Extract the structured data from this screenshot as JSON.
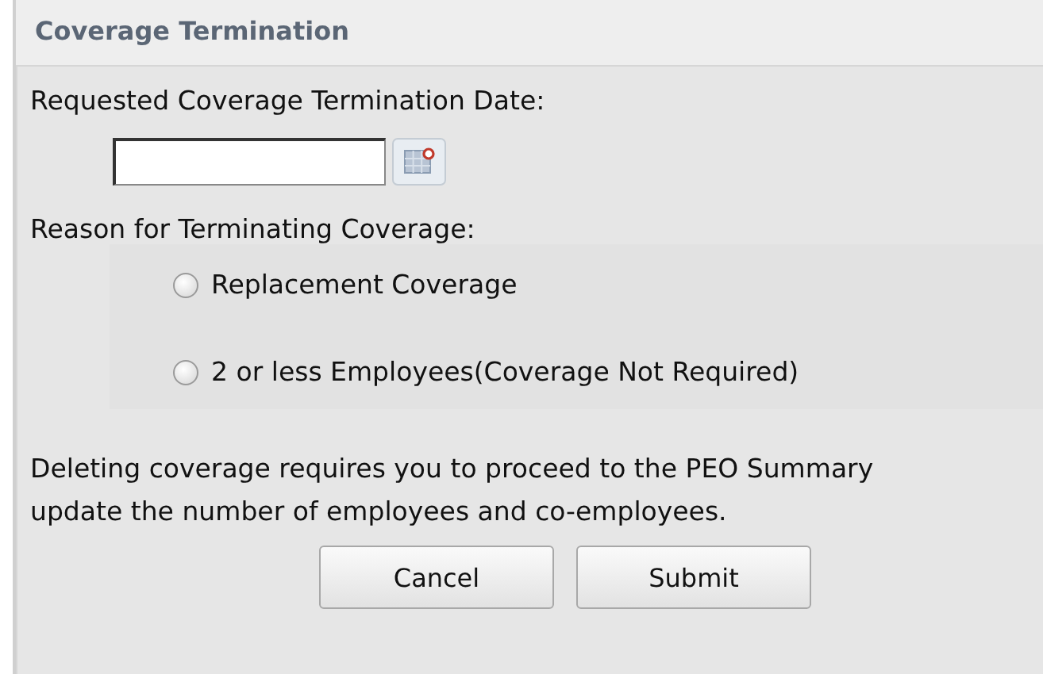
{
  "dialog": {
    "title": "Coverage Termination"
  },
  "date_label": "Requested Coverage Termination Date:",
  "reason_label": "Reason for Terminating Coverage:",
  "reasons": [
    {
      "label": "Replacement Coverage",
      "selected": false
    },
    {
      "label": "2 or less Employees(Coverage Not Required)",
      "selected": false
    }
  ],
  "note_lines": [
    "Deleting coverage requires you to proceed to the PEO Summary",
    "update the number of employees and co-employees."
  ],
  "buttons": [
    "Cancel",
    "Submit"
  ]
}
